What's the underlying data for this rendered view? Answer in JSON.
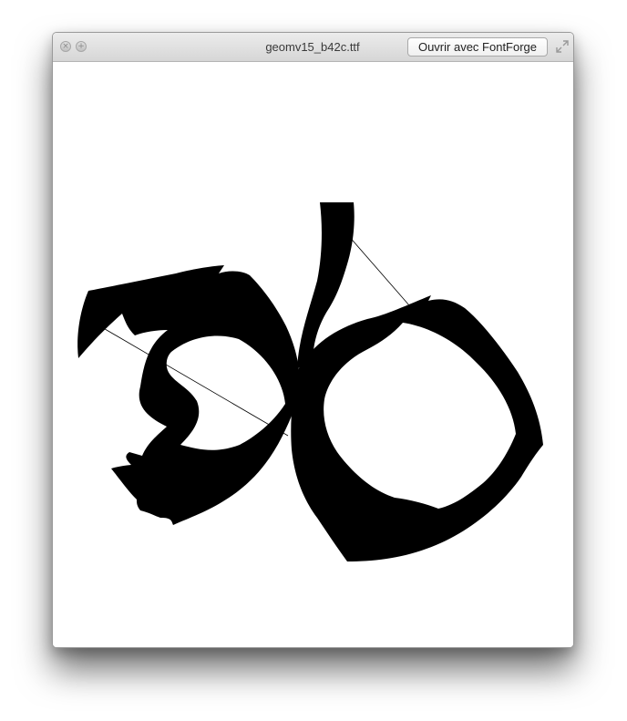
{
  "window": {
    "title": "geomv15_b42c.ttf",
    "open_button_label": "Ouvrir avec FontForge"
  },
  "icons": {
    "close": "close-icon",
    "zoom": "zoom-icon",
    "fullscreen": "fullscreen-icon"
  },
  "colors": {
    "glyph_fill": "#000000",
    "window_background": "#ffffff"
  }
}
